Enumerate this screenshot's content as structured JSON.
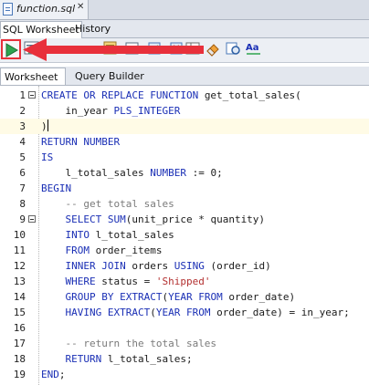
{
  "file_tab": {
    "title": "function.sql"
  },
  "sub_tabs": [
    {
      "label": "SQL Worksheet"
    },
    {
      "label": "History"
    }
  ],
  "editor_tabs": [
    {
      "label": "Worksheet"
    },
    {
      "label": "Query Builder"
    }
  ],
  "toolbar_icons": [
    "run-statement-icon",
    "run-script-icon",
    "autotrace-icon",
    "explain-plan-icon",
    "commit-icon",
    "rollback-icon",
    "eraser-icon",
    "sql-tuning-icon",
    "format-text-icon"
  ],
  "colors": {
    "highlight_border": "#e8303b",
    "keyword": "#1a2fb5",
    "string": "#b33030",
    "comment": "#7a7a7a"
  },
  "code_lines": [
    {
      "n": "1",
      "segments": [
        [
          "kw",
          "CREATE OR REPLACE FUNCTION"
        ],
        [
          "",
          "get_total_sales("
        ]
      ]
    },
    {
      "n": "2",
      "segments": [
        [
          "",
          "    in_year "
        ],
        [
          "kw",
          "PLS_INTEGER"
        ]
      ]
    },
    {
      "n": "3",
      "segments": [
        [
          "",
          ")"
        ]
      ]
    },
    {
      "n": "4",
      "segments": [
        [
          "kw",
          "RETURN NUMBER"
        ]
      ]
    },
    {
      "n": "5",
      "segments": [
        [
          "kw",
          "IS"
        ]
      ]
    },
    {
      "n": "6",
      "segments": [
        [
          "",
          "    l_total_sales "
        ],
        [
          "kw",
          "NUMBER"
        ],
        [
          "",
          " := 0;"
        ]
      ]
    },
    {
      "n": "7",
      "segments": [
        [
          "kw",
          "BEGIN"
        ]
      ]
    },
    {
      "n": "8",
      "segments": [
        [
          "cmt",
          "    -- get total sales"
        ]
      ]
    },
    {
      "n": "9",
      "segments": [
        [
          "",
          "    "
        ],
        [
          "kw",
          "SELECT SUM"
        ],
        [
          "",
          "(unit_price * quantity)"
        ]
      ]
    },
    {
      "n": "10",
      "segments": [
        [
          "",
          "    "
        ],
        [
          "kw",
          "INTO"
        ],
        [
          "",
          " l_total_sales"
        ]
      ]
    },
    {
      "n": "11",
      "segments": [
        [
          "",
          "    "
        ],
        [
          "kw",
          "FROM"
        ],
        [
          "",
          " order_items"
        ]
      ]
    },
    {
      "n": "12",
      "segments": [
        [
          "",
          "    "
        ],
        [
          "kw",
          "INNER JOIN"
        ],
        [
          "",
          " orders "
        ],
        [
          "kw",
          "USING"
        ],
        [
          "",
          " (order_id)"
        ]
      ]
    },
    {
      "n": "13",
      "segments": [
        [
          "",
          "    "
        ],
        [
          "kw",
          "WHERE"
        ],
        [
          "",
          " status = "
        ],
        [
          "str",
          "'Shipped'"
        ]
      ]
    },
    {
      "n": "14",
      "segments": [
        [
          "",
          "    "
        ],
        [
          "kw",
          "GROUP BY EXTRACT"
        ],
        [
          "",
          "("
        ],
        [
          "kw",
          "YEAR FROM"
        ],
        [
          "",
          " order_date)"
        ]
      ]
    },
    {
      "n": "15",
      "segments": [
        [
          "",
          "    "
        ],
        [
          "kw",
          "HAVING EXTRACT"
        ],
        [
          "",
          "("
        ],
        [
          "kw",
          "YEAR FROM"
        ],
        [
          "",
          " order_date) = in_year;"
        ]
      ]
    },
    {
      "n": "16",
      "segments": []
    },
    {
      "n": "17",
      "segments": [
        [
          "cmt",
          "    -- return the total sales"
        ]
      ]
    },
    {
      "n": "18",
      "segments": [
        [
          "",
          "    "
        ],
        [
          "kw",
          "RETURN"
        ],
        [
          "",
          " l_total_sales;"
        ]
      ]
    },
    {
      "n": "19",
      "segments": [
        [
          "kw",
          "END"
        ],
        [
          "",
          ";"
        ]
      ]
    }
  ]
}
